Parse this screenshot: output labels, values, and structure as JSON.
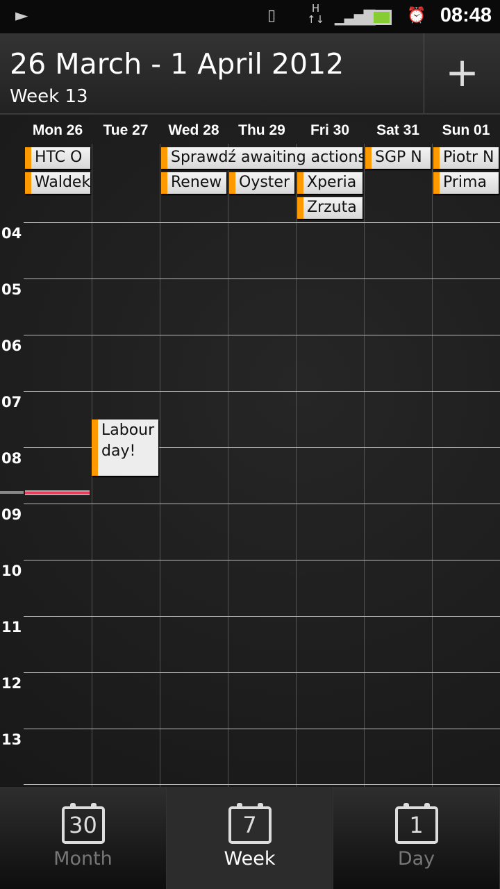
{
  "status": {
    "time": "08:48",
    "network": "H",
    "icons": [
      "play-icon",
      "vibrate-icon",
      "network-h-icon",
      "signal-icon",
      "battery-icon",
      "alarm-icon"
    ]
  },
  "header": {
    "title": "26 March - 1 April 2012",
    "week": "Week 13",
    "add_label": "+"
  },
  "days": [
    "Mon 26",
    "Tue 27",
    "Wed 28",
    "Thu 29",
    "Fri 30",
    "Sat 31",
    "Sun 01"
  ],
  "hours": [
    "04",
    "05",
    "06",
    "07",
    "08",
    "09",
    "10",
    "11",
    "12",
    "13"
  ],
  "all_day_events": [
    {
      "title": "HTC O",
      "day": 0,
      "row": 0,
      "span": 1
    },
    {
      "title": "Waldek",
      "day": 0,
      "row": 1,
      "span": 1
    },
    {
      "title": "Sprawdź awaiting actions",
      "day": 2,
      "row": 0,
      "span": 3
    },
    {
      "title": "Renew",
      "day": 2,
      "row": 1,
      "span": 1
    },
    {
      "title": "Oyster",
      "day": 3,
      "row": 1,
      "span": 1
    },
    {
      "title": "Xperia",
      "day": 4,
      "row": 1,
      "span": 1
    },
    {
      "title": "Zrzuta",
      "day": 4,
      "row": 2,
      "span": 1
    },
    {
      "title": "SGP N",
      "day": 5,
      "row": 0,
      "span": 1
    },
    {
      "title": "Piotr N",
      "day": 6,
      "row": 0,
      "span": 1
    },
    {
      "title": "Prima",
      "day": 6,
      "row": 1,
      "span": 1
    }
  ],
  "timed_events": [
    {
      "title": "Labour day!",
      "day": 1,
      "start": "07:30",
      "end": "08:30"
    }
  ],
  "current_time": "08:48",
  "accent": "#ff9900",
  "now_color": "#e33c5c",
  "tabs": [
    {
      "label": "Month",
      "icon_num": "30",
      "selected": false
    },
    {
      "label": "Week",
      "icon_num": "7",
      "selected": true
    },
    {
      "label": "Day",
      "icon_num": "1",
      "selected": false
    }
  ]
}
